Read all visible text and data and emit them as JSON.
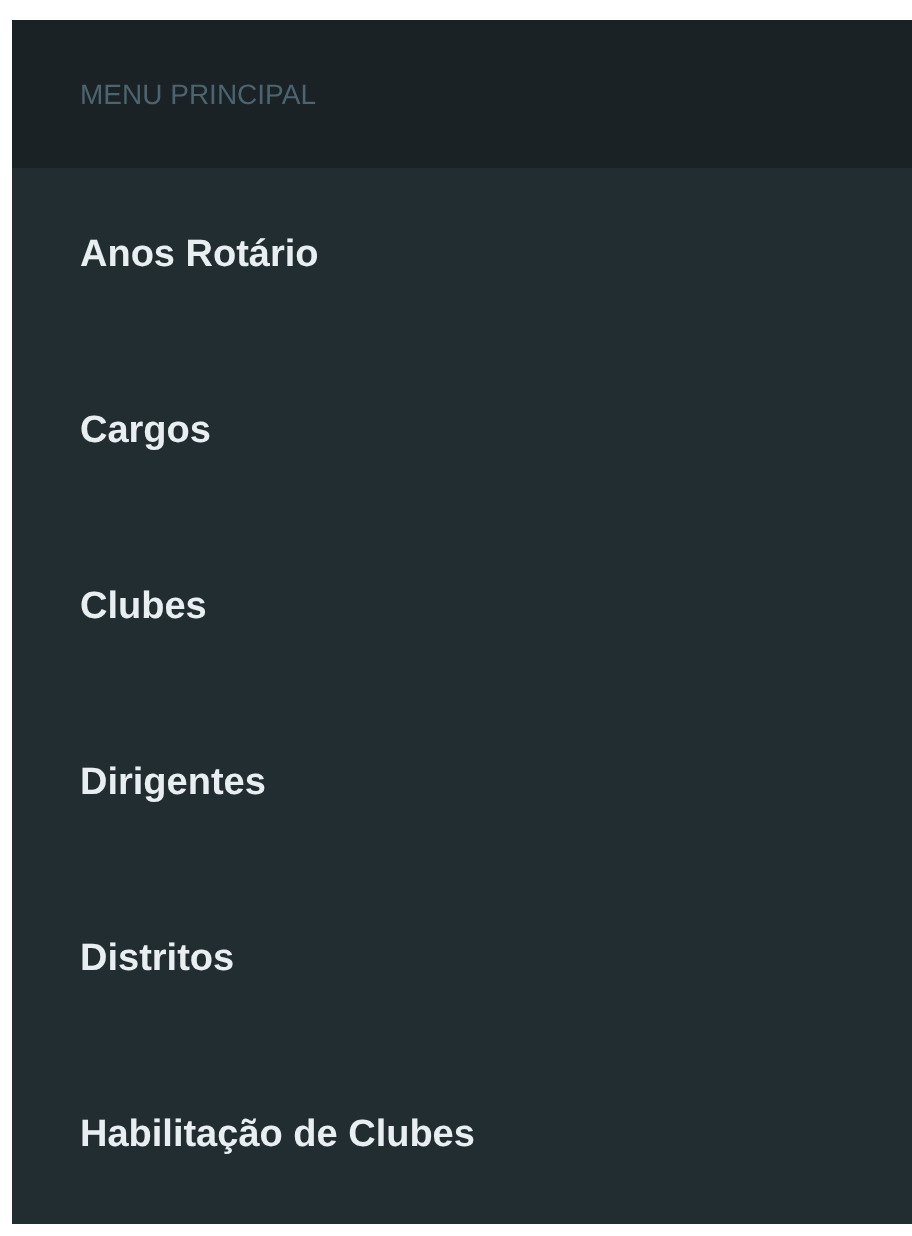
{
  "menu": {
    "header": "MENU PRINCIPAL",
    "items": [
      {
        "label": "Anos Rotário"
      },
      {
        "label": "Cargos"
      },
      {
        "label": "Clubes"
      },
      {
        "label": "Dirigentes"
      },
      {
        "label": "Distritos"
      },
      {
        "label": "Habilitação de Clubes"
      }
    ]
  }
}
